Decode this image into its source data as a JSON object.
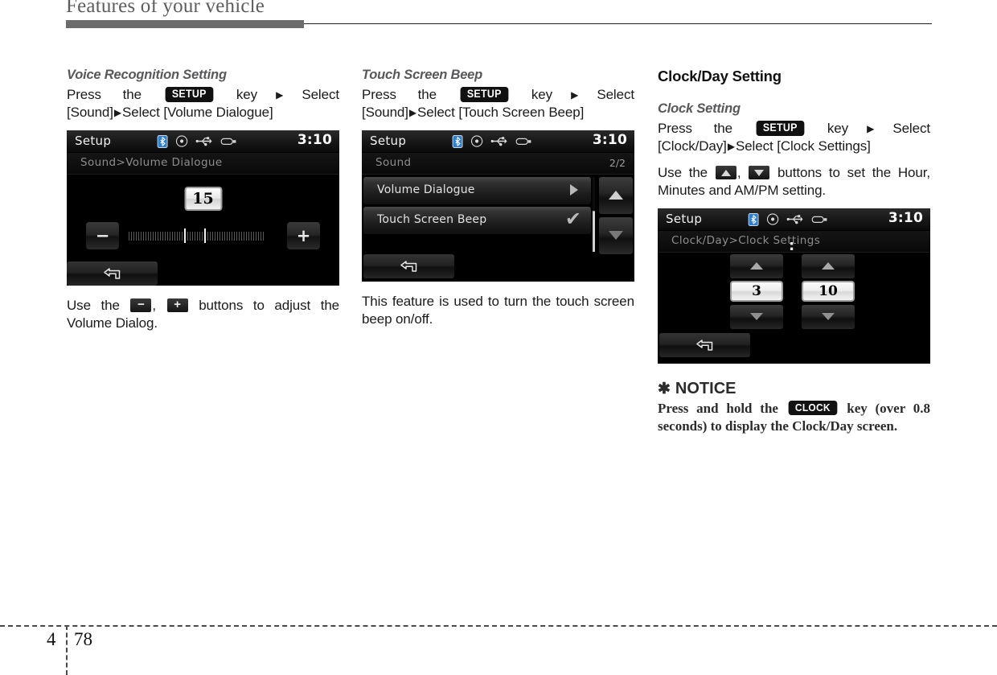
{
  "header": {
    "title": "Features of your vehicle"
  },
  "footer": {
    "chapter": "4",
    "page": "78"
  },
  "columns": {
    "left": {
      "heading": "Voice Recognition Setting",
      "instruction": {
        "part1": "Press the",
        "key": "SETUP",
        "part2": "key",
        "arrow1": "▶",
        "part3": "Select [Sound]",
        "arrow2": "▶",
        "part4": "Select [Volume Dialogue]"
      },
      "caption": {
        "part1": "Use the",
        "key_minus": "−",
        "sep": ",",
        "key_plus": "+",
        "part2": "buttons to adjust the Volume Dialog."
      },
      "screen": {
        "title": "Setup",
        "time": "3:10",
        "breadcrumb": "Sound>Volume Dialogue",
        "value": "15",
        "minus_label": "−",
        "plus_label": "+",
        "icons": [
          "bluetooth-icon",
          "disc-icon",
          "usb-icon",
          "device-icon"
        ],
        "back_label": "back-arrow-icon"
      }
    },
    "middle": {
      "heading": "Touch Screen Beep",
      "instruction": {
        "part1": "Press the",
        "key": "SETUP",
        "part2": "key",
        "arrow1": "▶",
        "part3": "Select [Sound]",
        "arrow2": "▶",
        "part4": "Select [Touch Screen Beep]"
      },
      "caption": "This feature is used to turn the touch screen beep on/off.",
      "screen": {
        "title": "Setup",
        "time": "3:10",
        "breadcrumb": "Sound",
        "page_indicator": "2/2",
        "rows": [
          {
            "label": "Volume Dialogue",
            "accessory": "chevron-right-icon"
          },
          {
            "label": "Touch Screen Beep",
            "accessory": "check-icon",
            "check": "✔"
          }
        ],
        "scroll_up": "scroll-up-icon",
        "scroll_down": "scroll-down-icon",
        "back_label": "back-arrow-icon"
      }
    },
    "right": {
      "heading": "Clock/Day Setting",
      "subheading": "Clock Setting",
      "instruction": {
        "part1": "Press the",
        "key": "SETUP",
        "part2": "key",
        "arrow1": "▶",
        "part3": "Select [Clock/Day]",
        "arrow2": "▶",
        "part4": "Select [Clock Settings]"
      },
      "caption": {
        "part1": "Use the",
        "sep": ",",
        "part2": "buttons to set the Hour, Minutes and AM/PM setting."
      },
      "screen": {
        "title": "Setup",
        "time": "3:10",
        "breadcrumb": "Clock/Day>Clock Settings",
        "hour": "3",
        "minute": "10",
        "colon": ":",
        "back_label": "back-arrow-icon"
      },
      "notice": {
        "star": "✱",
        "title": "NOTICE",
        "body_part1": "Press and hold the",
        "key": "CLOCK",
        "body_part2": "key (over 0.8 seconds) to display the Clock/Day screen."
      }
    }
  },
  "colors": {
    "header_bar": "#6b6b6b",
    "heading_gray": "#58585a",
    "badge_bg": "#111111",
    "screen_bg": "#000000",
    "bluetooth": "#2f7fd0"
  }
}
